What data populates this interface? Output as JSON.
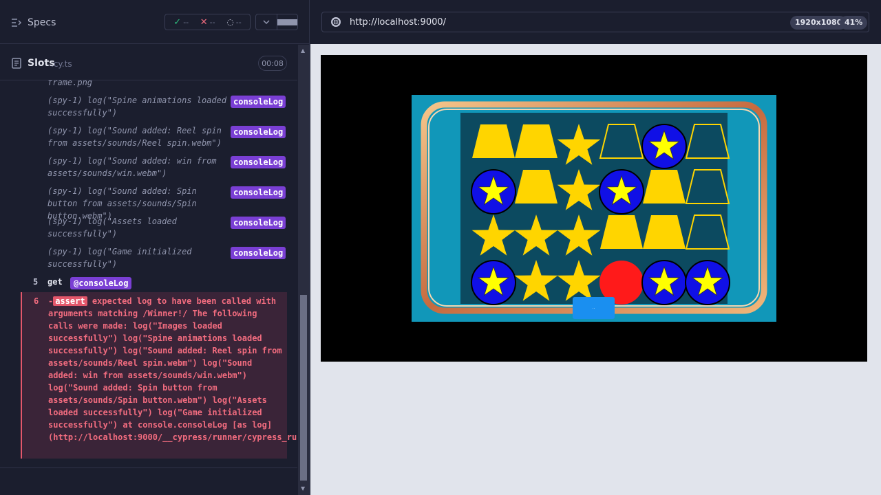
{
  "left": {
    "specs_label": "Specs",
    "stats": {
      "passed": "--",
      "failed": "--",
      "pending": "--"
    },
    "spec_file": {
      "name": "Slots",
      "ext": ".cy.ts",
      "timer": "00:08"
    },
    "log_fragment": "frame.png",
    "console_calls": [
      {
        "text": "(spy-1)  log(\"Spine animations loaded successfully\")",
        "badge": "consoleLog"
      },
      {
        "text": "(spy-1)  log(\"Sound added: Reel spin from assets/sounds/Reel spin.webm\")",
        "badge": "consoleLog"
      },
      {
        "text": "(spy-1)  log(\"Sound added: win from assets/sounds/win.webm\")",
        "badge": "consoleLog"
      },
      {
        "text": "(spy-1)  log(\"Sound added: Spin button from assets/sounds/Spin button.webm\")",
        "badge": "consoleLog"
      },
      {
        "text": "(spy-1)  log(\"Assets loaded successfully\")",
        "badge": "consoleLog"
      },
      {
        "text": "(spy-1)  log(\"Game initialized successfully\")",
        "badge": "consoleLog"
      }
    ],
    "get_row": {
      "num": "5",
      "command": "get",
      "alias": "@consoleLog"
    },
    "error_row": {
      "num": "6",
      "prefix": "-",
      "tag": "assert",
      "message": " expected log to have been called with arguments matching /Winner!/ The following calls were made: log(\"Images loaded successfully\") log(\"Spine animations loaded successfully\") log(\"Sound added: Reel spin from assets/sounds/Reel spin.webm\") log(\"Sound added: win from assets/sounds/win.webm\") log(\"Sound added: Spin button from assets/sounds/Spin button.webm\") log(\"Assets loaded successfully\") log(\"Game initialized successfully\") at console.consoleLog [as log] (http://localhost:9000/__cypress/runner/cypress_runner.js:52996:26)"
    }
  },
  "right": {
    "url": "http://localhost:9000/",
    "viewport": "1920x1080",
    "zoom": "41%",
    "game": {
      "spin_button_label": "..",
      "reels": [
        [
          "trapezoid-filled",
          "circle-star",
          "star",
          "circle-star",
          "trapezoid-outline"
        ],
        [
          "trapezoid-filled",
          "trapezoid-filled",
          "star",
          "star"
        ],
        [
          "star",
          "star",
          "star",
          "star-placeholder"
        ],
        [
          "trapezoid-outline",
          "circle-star",
          "trapezoid-filled",
          "red-circle"
        ],
        [
          "circle-star",
          "trapezoid-filled",
          "trapezoid-filled",
          "circle-star"
        ],
        [
          "trapezoid-outline",
          "trapezoid-outline",
          "trapezoid-outline",
          "circle-star"
        ]
      ]
    }
  },
  "colors": {
    "accent": "#7a3fd4",
    "error": "#f26c7f",
    "frame": "#1197b9",
    "panel": "#0c4a60",
    "gold": "#ffd500",
    "blue": "#1010e6",
    "red": "#ff1a1a"
  }
}
